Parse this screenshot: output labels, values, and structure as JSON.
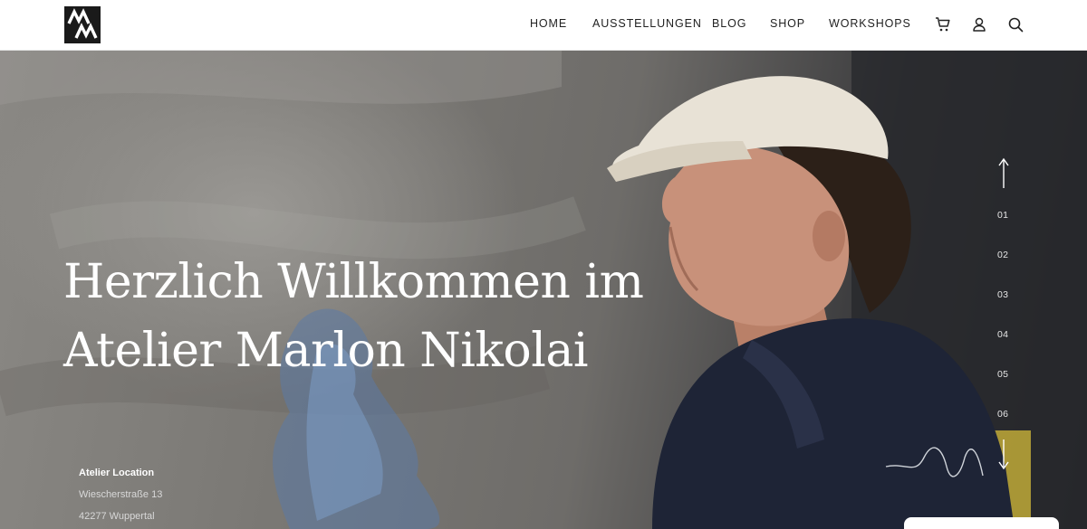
{
  "header": {
    "logo_icon": "mn-monogram-logo",
    "nav": [
      {
        "label": "HOME"
      },
      {
        "label": "AUSSTELLUNGEN"
      },
      {
        "label": "BLOG"
      },
      {
        "label": "SHOP"
      },
      {
        "label": "WORKSHOPS"
      }
    ],
    "icons": [
      "cart-icon",
      "user-icon",
      "search-icon"
    ]
  },
  "hero": {
    "title_line1": "Herzlich Willkommen im",
    "title_line2": "Atelier Marlon Nikolai",
    "location": {
      "heading": "Atelier Location",
      "street": "Wiescherstraße 13",
      "city": "42277 Wuppertal"
    },
    "slides": [
      "01",
      "02",
      "03",
      "04",
      "05",
      "06"
    ],
    "arrow_icons": [
      "arrow-up-icon",
      "arrow-down-icon"
    ]
  },
  "colors": {
    "header_bg": "#ffffff",
    "nav_text": "#222222",
    "hero_text": "#ffffff",
    "jacket": "#1e2436",
    "cap": "#e8e2d6"
  }
}
